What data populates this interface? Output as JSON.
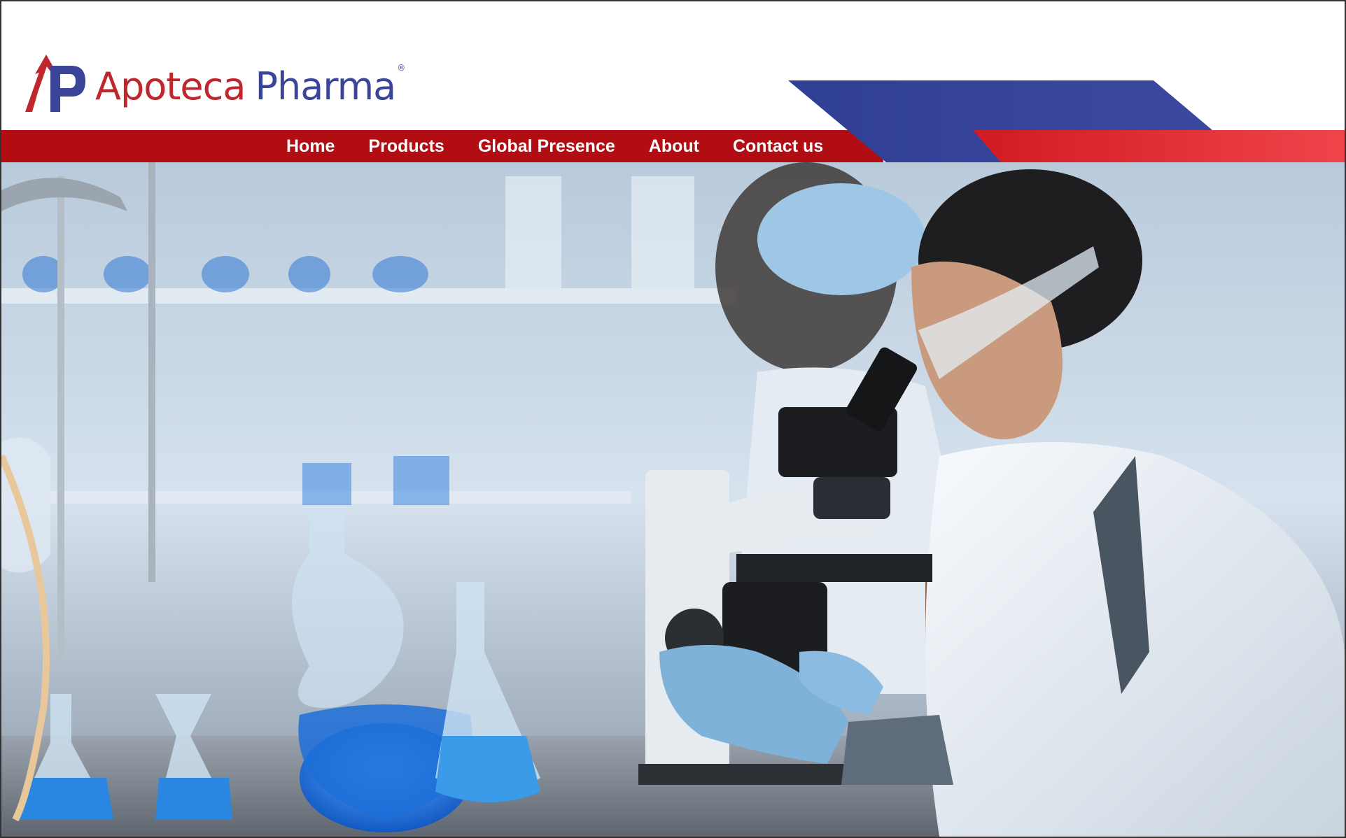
{
  "brand": {
    "name_part1": "Apoteca",
    "name_part2": "Pharma",
    "registered_mark": "®",
    "logo_icon": "ap-monogram-logo",
    "colors": {
      "red": "#c0272d",
      "blue": "#3b4597",
      "nav_red": "#b20d12"
    }
  },
  "nav": {
    "items": [
      {
        "label": "Home"
      },
      {
        "label": "Products"
      },
      {
        "label": "Global Presence"
      },
      {
        "label": "About"
      },
      {
        "label": "Contact us"
      }
    ]
  },
  "hero": {
    "image": "laboratory-scientists-microscope-photo"
  }
}
